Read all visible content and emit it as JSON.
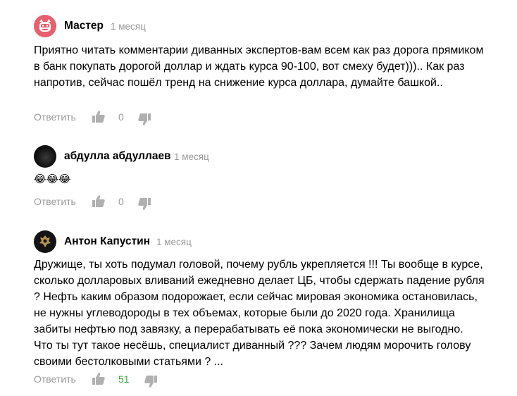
{
  "comments": [
    {
      "author": "Мастер",
      "date": "1 месяц",
      "text": "Приятно читать комментарии диванных экспертов-вам всем как раз дорога прямиком в банк покупать дорогой доллар и ждать курса 90-100, вот смеху будет))).. Как раз напротив, сейчас пошёл тренд на снижение курса доллара, думайте башкой..",
      "reply_label": "Ответить",
      "likes": "0"
    },
    {
      "author": "абдулла абдуллаев",
      "date": "1 месяц",
      "text": "😂😂😂",
      "reply_label": "Ответить",
      "likes": "0"
    },
    {
      "author": "Антон Капустин",
      "date": "1 месяц",
      "text": "Дружище, ты хоть подумал головой, почему рубль укрепляется !!! Ты вообще в курсе, сколько долларовых вливаний ежедневно делает ЦБ, чтобы сдержать падение рубля ? Нефть каким образом подорожает, если сейчас мировая экономика остановилась, не нужны углеводороды в тех объемах, которые были до 2020 года. Хранилища забиты нефтью под завязку, а перерабатывать её пока экономически не выгодно. Что ты тут такое несёшь, специалист диванный ??? Зачем людям морочить голову своими бестолковыми статьями ? ...",
      "reply_label": "Ответить",
      "likes": "51"
    }
  ],
  "colors": {
    "meta_gray": "#999999",
    "positive_count": "#36a42d",
    "icon_gray": "#b0b0b0",
    "master_avatar": "#e85f6e"
  }
}
